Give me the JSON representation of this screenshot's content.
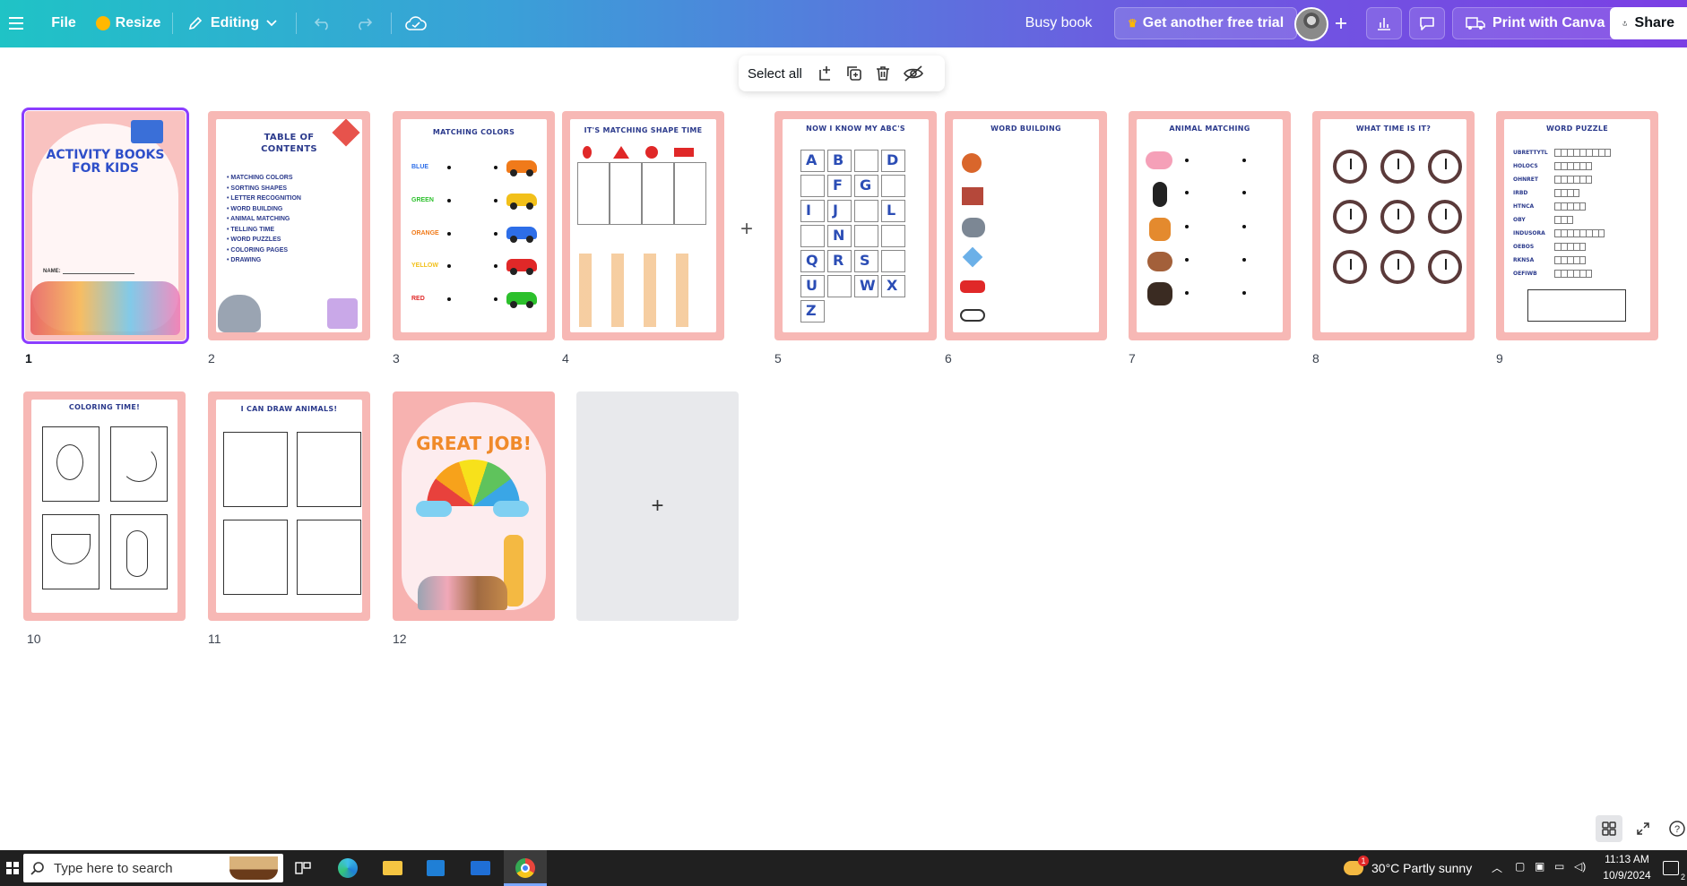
{
  "topbar": {
    "file": "File",
    "resize": "Resize",
    "editing": "Editing",
    "doc_title": "Busy book",
    "trial": "Get another free trial",
    "print": "Print with Canva",
    "share": "Share"
  },
  "floating_toolbar": {
    "select_all": "Select all"
  },
  "pages": [
    {
      "num": "1",
      "title": "ACTIVITY BOOKS FOR KIDS",
      "name_label": "NAME:"
    },
    {
      "num": "2",
      "title": "TABLE OF CONTENTS",
      "items": [
        "MATCHING COLORS",
        "SORTING SHAPES",
        "LETTER RECOGNITION",
        "WORD BUILDING",
        "ANIMAL MATCHING",
        "TELLING TIME",
        "WORD PUZZLES",
        "COLORING PAGES",
        "DRAWING"
      ]
    },
    {
      "num": "3",
      "title": "MATCHING COLORS",
      "colors": [
        "BLUE",
        "GREEN",
        "ORANGE",
        "YELLOW",
        "RED"
      ]
    },
    {
      "num": "4",
      "title": "IT'S MATCHING SHAPE TIME"
    },
    {
      "num": "5",
      "title": "NOW I KNOW MY ABC'S",
      "letters": [
        "A",
        "B",
        "",
        "D",
        "",
        "F",
        "G",
        "",
        "I",
        "J",
        "",
        "L",
        "",
        "N",
        "",
        "",
        "Q",
        "R",
        "S",
        "",
        "U",
        "",
        "W",
        "X",
        "Z"
      ]
    },
    {
      "num": "6",
      "title": "WORD BUILDING"
    },
    {
      "num": "7",
      "title": "ANIMAL MATCHING"
    },
    {
      "num": "8",
      "title": "WHAT TIME IS IT?"
    },
    {
      "num": "9",
      "title": "WORD PUZZLE",
      "words": [
        "UBRETTYTL",
        "HOLOCS",
        "OHNRET",
        "IRBD",
        "HTNCA",
        "OBY",
        "INDUSORA",
        "OEBOS",
        "RKNSA",
        "OEFIWB"
      ]
    },
    {
      "num": "10",
      "title": "COLORING TIME!"
    },
    {
      "num": "11",
      "title": "I CAN DRAW ANIMALS!"
    },
    {
      "num": "12",
      "title": "GREAT JOB!"
    }
  ],
  "taskbar": {
    "search_placeholder": "Type here to search",
    "weather": "30°C  Partly sunny",
    "weather_badge": "1",
    "time": "11:13 AM",
    "date": "10/9/2024",
    "notif_count": "2"
  },
  "colors": {
    "accent": "#8b3dff",
    "page_border": "#f7b8b5",
    "title_blue": "#2b3a8c"
  }
}
